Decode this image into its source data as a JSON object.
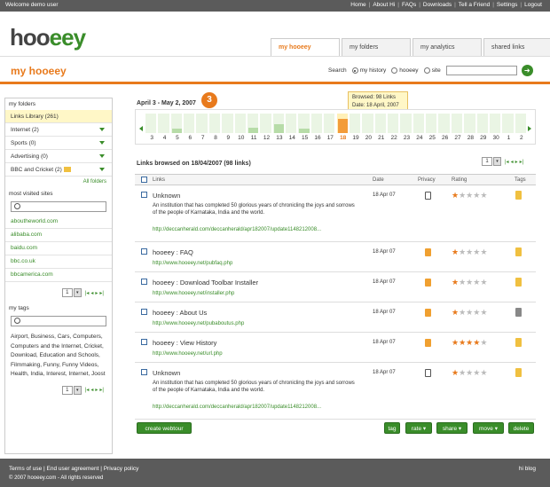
{
  "topbar": {
    "welcome": "Welcome demo user",
    "links": [
      "Home",
      "About Hi",
      "FAQs",
      "Downloads",
      "Tell a Friend",
      "Settings",
      "Logout"
    ]
  },
  "logo": {
    "part1": "hoo",
    "part2": "eey"
  },
  "tabs": [
    "my hooeey",
    "my folders",
    "my analytics",
    "shared links"
  ],
  "subheader": {
    "title": "my hooeey",
    "search_label": "Search",
    "options": [
      "my history",
      "hooeey",
      "site"
    ],
    "selected_option": 0,
    "search_value": "",
    "go_icon": "arrow-right-icon"
  },
  "sidebar": {
    "folders_heading": "my folders",
    "folders": [
      {
        "label": "Links Library (261)",
        "selected": true,
        "arrow": false
      },
      {
        "label": "Internet (2)",
        "selected": false,
        "arrow": true
      },
      {
        "label": "Sports (0)",
        "selected": false,
        "arrow": true
      },
      {
        "label": "Advertising (0)",
        "selected": false,
        "arrow": true
      },
      {
        "label": "BBC and Cricket (2)",
        "selected": false,
        "arrow": true
      }
    ],
    "all_folders": "All folders",
    "sites_heading": "most visited sites",
    "sites": [
      "aboutheworld.com",
      "alibaba.com",
      "baidu.com",
      "bbc.co.uk",
      "bbcamerica.com"
    ],
    "sites_page": "1",
    "tags_heading": "my tags",
    "tags_text": "Airport, Business, Cars, Computers, Computers and the Internet, Cricket, Download, Education and Schools, Filmmaking, Funny, Funny Videos, Health, India, Interest, Internet, Joost",
    "tags_page": "1"
  },
  "main": {
    "badge": "3",
    "date_range": "April 3 - May 2, 2007",
    "tooltip_line1": "Browsed: 98 Links",
    "tooltip_line2": "Date: 18 April, 2007",
    "timeline_labels": [
      "3",
      "4",
      "5",
      "6",
      "7",
      "8",
      "9",
      "10",
      "11",
      "12",
      "13",
      "14",
      "15",
      "16",
      "17",
      "18",
      "19",
      "20",
      "21",
      "22",
      "23",
      "24",
      "25",
      "26",
      "27",
      "28",
      "29",
      "30",
      "1",
      "2"
    ],
    "timeline_values": [
      0,
      0,
      0.3,
      0,
      0,
      0,
      0,
      0,
      0.4,
      0,
      0.6,
      0,
      0.3,
      0,
      0,
      1,
      0,
      0,
      0,
      0,
      0,
      0,
      0,
      0,
      0,
      0,
      0,
      0,
      0,
      0
    ],
    "timeline_selected": 15,
    "links_title": "Links browsed on 18/04/2007 (98 links)",
    "page": "1",
    "columns": {
      "links": "Links",
      "date": "Date",
      "privacy": "Privacy",
      "rating": "Rating",
      "tags": "Tags"
    },
    "rows": [
      {
        "title": "Unknown",
        "desc": "An institution that has completed 50 glorious years of chronicling the joys and sorrows of the people of Karnataka, India and the world.",
        "url": "http://deccanherald.com/deccanherald/apr182007/update1148212008...",
        "date": "18 Apr 07",
        "privacy": "unlocked",
        "rating": 1,
        "tag": "yellow"
      },
      {
        "title": "hooeey : FAQ",
        "desc": "",
        "url": "http://www.hooeey.net/pubfaq.php",
        "date": "18 Apr 07",
        "privacy": "locked",
        "rating": 1,
        "tag": "yellow"
      },
      {
        "title": "hooeey : Download Toolbar Installer",
        "desc": "",
        "url": "http://www.hooeey.net/installer.php",
        "date": "18 Apr 07",
        "privacy": "locked",
        "rating": 1,
        "tag": "yellow"
      },
      {
        "title": "hooeey : About Us",
        "desc": "",
        "url": "http://www.hooeey.net/pubaboutus.php",
        "date": "18 Apr 07",
        "privacy": "locked",
        "rating": 1,
        "tag": "grey"
      },
      {
        "title": "hooeey : View History",
        "desc": "",
        "url": "http://www.hooeey.net/url.php",
        "date": "18 Apr 07",
        "privacy": "locked",
        "rating": 4,
        "tag": "yellow"
      },
      {
        "title": "Unknown",
        "desc": "An institution that has completed 50 glorious years of chronicling the joys and sorrows of the people of Karnataka, India and the world.",
        "url": "http://deccanherald.com/deccanherald/apr182007/update1148212008...",
        "date": "18 Apr 07",
        "privacy": "unlocked",
        "rating": 1,
        "tag": "yellow"
      }
    ],
    "buttons": {
      "create": "create webtour",
      "tag": "tag",
      "rate": "rate ▾",
      "share": "share ▾",
      "move": "move ▾",
      "delete": "delete"
    }
  },
  "footer": {
    "links": "Terms of use | End user agreement | Privacy policy",
    "copyright": "© 2007 hooeey.com - All rights reserved",
    "blog": "hi blog"
  }
}
